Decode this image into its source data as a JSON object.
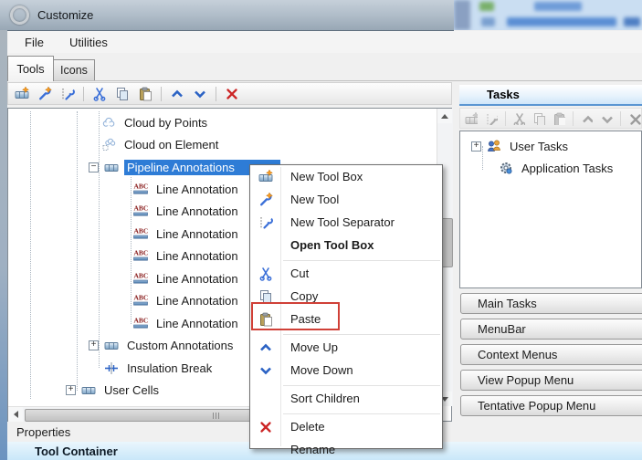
{
  "window": {
    "title": "Customize"
  },
  "menubar": {
    "items": [
      {
        "label": "File"
      },
      {
        "label": "Utilities"
      }
    ]
  },
  "tabs": {
    "items": [
      {
        "label": "Tools",
        "selected": true
      },
      {
        "label": "Icons",
        "selected": false
      }
    ]
  },
  "tools_toolbar": {
    "icons": [
      "new-tool-box",
      "new-tool",
      "new-tool-separator",
      "cut",
      "copy",
      "paste",
      "move-up",
      "move-down",
      "delete"
    ]
  },
  "tool_tree": {
    "items": [
      {
        "label": "Cloud by Points",
        "icon": "cloud",
        "level": 2
      },
      {
        "label": "Cloud on Element",
        "icon": "cloud-on-element",
        "level": 2
      },
      {
        "label": "Pipeline Annotations",
        "icon": "toolbox",
        "level": 2,
        "expander": "−",
        "selected": true
      },
      {
        "label": "Line Annotation",
        "icon": "abc",
        "level": 3
      },
      {
        "label": "Line Annotation",
        "icon": "abc",
        "level": 3
      },
      {
        "label": "Line Annotation",
        "icon": "abc",
        "level": 3
      },
      {
        "label": "Line Annotation",
        "icon": "abc",
        "level": 3
      },
      {
        "label": "Line Annotation",
        "icon": "abc",
        "level": 3
      },
      {
        "label": "Line Annotation",
        "icon": "abc",
        "level": 3
      },
      {
        "label": "Line Annotation",
        "icon": "abc",
        "level": 3
      },
      {
        "label": "Custom Annotations",
        "icon": "toolbox",
        "level": 2,
        "expander": "+"
      },
      {
        "label": "Insulation Break",
        "icon": "insulation-break",
        "level": 2
      },
      {
        "label": "User Cells",
        "icon": "toolbox",
        "level": 1,
        "expander": "+"
      }
    ]
  },
  "context_menu": {
    "items": [
      {
        "label": "New Tool Box",
        "icon": "new-tool-box"
      },
      {
        "label": "New Tool",
        "icon": "new-tool"
      },
      {
        "label": "New Tool Separator",
        "icon": "new-tool-separator"
      },
      {
        "label": "Open Tool Box",
        "bold": true
      },
      {
        "label": "Cut",
        "icon": "cut"
      },
      {
        "label": "Copy",
        "icon": "copy"
      },
      {
        "label": "Paste",
        "icon": "paste",
        "highlighted": true
      },
      {
        "label": "Move Up",
        "icon": "move-up"
      },
      {
        "label": "Move Down",
        "icon": "move-down"
      },
      {
        "label": "Sort Children"
      },
      {
        "label": "Delete",
        "icon": "delete"
      },
      {
        "label": "Rename"
      }
    ]
  },
  "tasks_panel": {
    "title": "Tasks",
    "toolbar_icons": [
      "new-tool-box",
      "new-tool-separator",
      "cut",
      "copy",
      "paste",
      "move-up",
      "move-down",
      "delete"
    ],
    "tree": [
      {
        "label": "User Tasks",
        "icon": "user-tasks",
        "expander": "+"
      },
      {
        "label": "Application Tasks",
        "icon": "application-tasks"
      }
    ],
    "buttons": [
      {
        "label": "Main Tasks"
      },
      {
        "label": "MenuBar"
      },
      {
        "label": "Context Menus"
      },
      {
        "label": "View Popup Menu"
      },
      {
        "label": "Tentative Popup Menu"
      }
    ]
  },
  "bottom": {
    "properties_label": "Properties",
    "container_title": "Tool Container"
  },
  "colors": {
    "selection": "#2e7cd6",
    "annotation_box": "#d04037",
    "tasks_header_accent": "#5a96d2",
    "titlebar": "#aebbc7"
  }
}
